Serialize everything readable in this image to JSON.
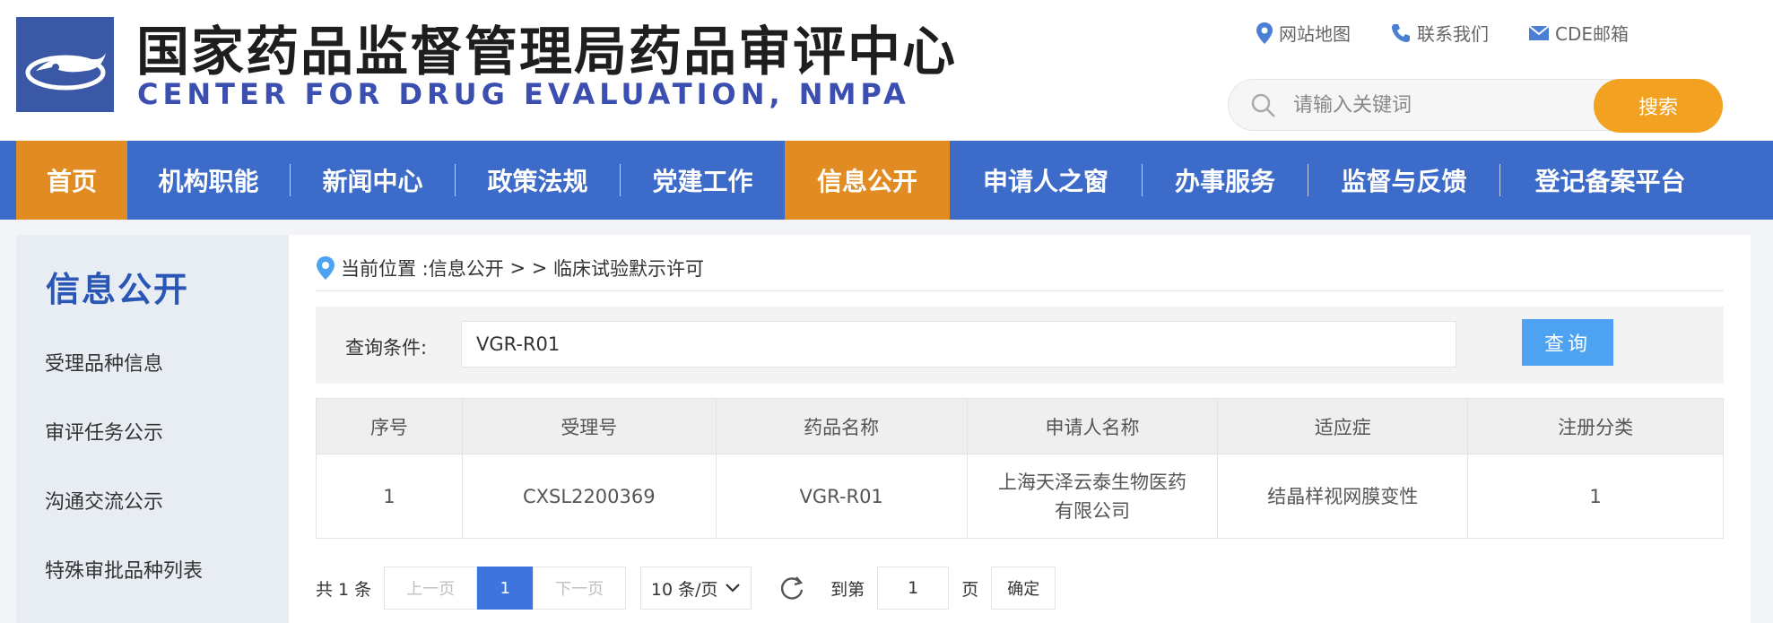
{
  "header": {
    "title_cn": "国家药品监督管理局药品审评中心",
    "title_en": "CENTER FOR DRUG EVALUATION, NMPA",
    "logo_icon": "cde-logo-icon",
    "links": [
      {
        "label": "网站地图",
        "icon": "location-pin-icon"
      },
      {
        "label": "联系我们",
        "icon": "phone-icon"
      },
      {
        "label": "CDE邮箱",
        "icon": "mail-icon"
      }
    ],
    "search": {
      "placeholder": "请输入关键词",
      "button": "搜索"
    }
  },
  "nav": {
    "items": [
      {
        "label": "首页",
        "active": true
      },
      {
        "label": "机构职能",
        "active": false
      },
      {
        "label": "新闻中心",
        "active": false
      },
      {
        "label": "政策法规",
        "active": false
      },
      {
        "label": "党建工作",
        "active": false
      },
      {
        "label": "信息公开",
        "active": true
      },
      {
        "label": "申请人之窗",
        "active": false
      },
      {
        "label": "办事服务",
        "active": false
      },
      {
        "label": "监督与反馈",
        "active": false
      },
      {
        "label": "登记备案平台",
        "active": false
      }
    ]
  },
  "sidebar": {
    "title": "信息公开",
    "items": [
      "受理品种信息",
      "审评任务公示",
      "沟通交流公示",
      "特殊审批品种列表"
    ]
  },
  "breadcrumb": {
    "prefix": "当前位置 : ",
    "section": "信息公开",
    "sep": " > > ",
    "current": "临床试验默示许可"
  },
  "query": {
    "label": "查询条件:",
    "value": "VGR-R01",
    "button": "查询"
  },
  "table": {
    "headers": [
      "序号",
      "受理号",
      "药品名称",
      "申请人名称",
      "适应症",
      "注册分类"
    ],
    "rows": [
      [
        "1",
        "CXSL2200369",
        "VGR-R01",
        "上海天泽云泰生物医药有限公司",
        "结晶样视网膜变性",
        "1"
      ]
    ]
  },
  "pager": {
    "total": "共 1 条",
    "prev": "上一页",
    "current": "1",
    "next": "下一页",
    "page_size": "10 条/页",
    "goto_label": "到第",
    "goto_value": "1",
    "page_label": "页",
    "confirm": "确定"
  },
  "colors": {
    "nav_bg": "#3d6bc9",
    "nav_active": "#e08c23",
    "search_button": "#f2a220",
    "query_button": "#4da3f2",
    "pager_current": "#3e75dd",
    "sidebar_title": "#2a56b6"
  }
}
